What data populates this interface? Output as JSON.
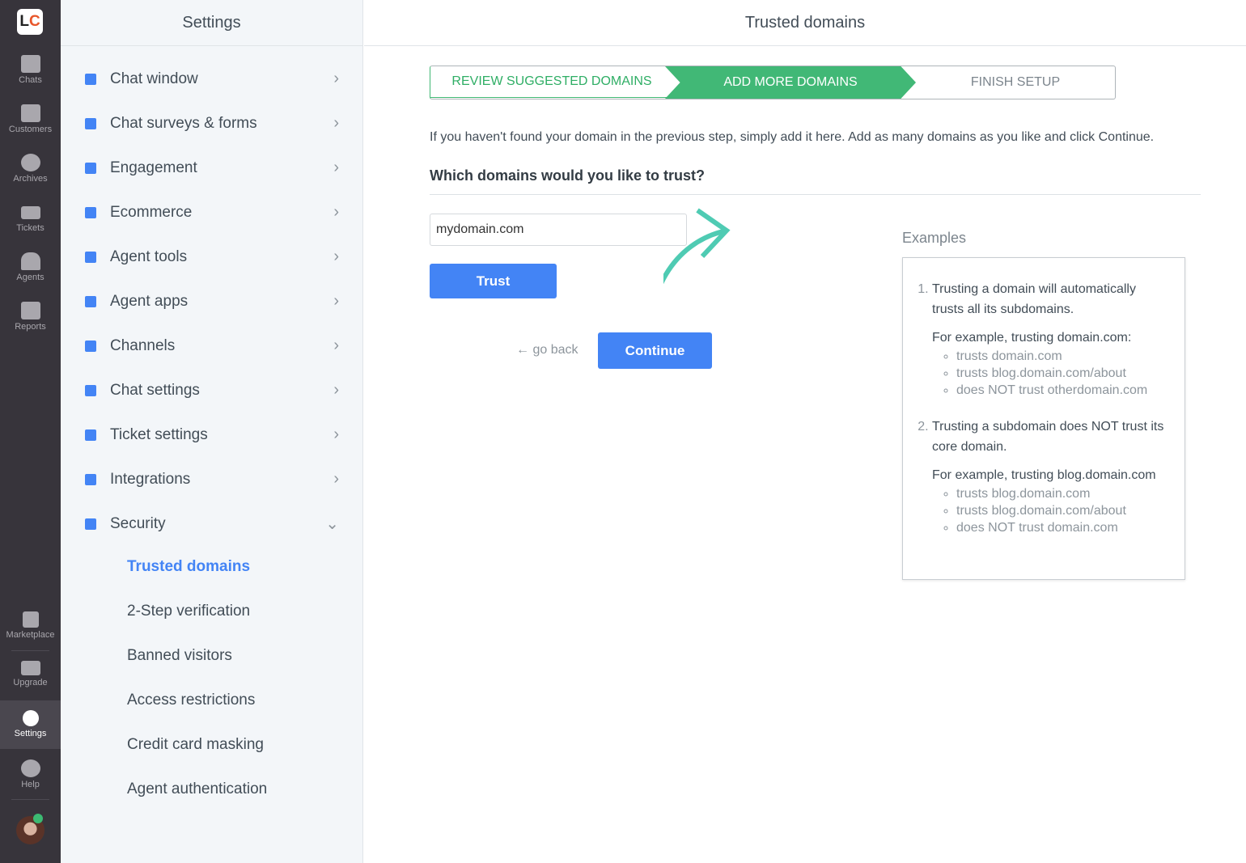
{
  "rail": {
    "logo": "LC",
    "items": [
      {
        "label": "Chats",
        "icon": "chat-icon"
      },
      {
        "label": "Customers",
        "icon": "customers-icon"
      },
      {
        "label": "Archives",
        "icon": "clock-icon"
      },
      {
        "label": "Tickets",
        "icon": "ticket-icon"
      },
      {
        "label": "Agents",
        "icon": "agents-icon"
      },
      {
        "label": "Reports",
        "icon": "reports-icon"
      }
    ],
    "bottom": [
      {
        "label": "Marketplace",
        "icon": "grid-icon"
      },
      {
        "label": "Upgrade",
        "icon": "card-icon"
      },
      {
        "label": "Settings",
        "icon": "gear-icon",
        "active": true
      },
      {
        "label": "Help",
        "icon": "help-icon"
      }
    ],
    "status_color": "#3cba72"
  },
  "sidebar": {
    "title": "Settings",
    "items": [
      {
        "label": "Chat window"
      },
      {
        "label": "Chat surveys & forms"
      },
      {
        "label": "Engagement"
      },
      {
        "label": "Ecommerce"
      },
      {
        "label": "Agent tools"
      },
      {
        "label": "Agent apps"
      },
      {
        "label": "Channels"
      },
      {
        "label": "Chat settings"
      },
      {
        "label": "Ticket settings"
      },
      {
        "label": "Integrations"
      },
      {
        "label": "Security",
        "expanded": true
      }
    ],
    "security_sub": [
      {
        "label": "Trusted domains",
        "active": true
      },
      {
        "label": "2-Step verification"
      },
      {
        "label": "Banned visitors"
      },
      {
        "label": "Access restrictions"
      },
      {
        "label": "Credit card masking"
      },
      {
        "label": "Agent authentication"
      }
    ]
  },
  "main": {
    "title": "Trusted domains",
    "steps": [
      {
        "label": "REVIEW SUGGESTED DOMAINS",
        "state": "done"
      },
      {
        "label": "ADD MORE DOMAINS",
        "state": "active"
      },
      {
        "label": "FINISH SETUP",
        "state": "pending"
      }
    ],
    "intro": "If you haven't found your domain in the previous step, simply add it here. Add as many domains as you like and click Continue.",
    "question": "Which domains would you like to trust?",
    "domain_input": "mydomain.com",
    "trust": "Trust",
    "back": "← go back",
    "continue": "Continue",
    "examples": {
      "title": "Examples",
      "e1": "Trusting a domain will automatically trusts all its subdomains.",
      "e1_for": "For example, trusting domain.com:",
      "e1_list": [
        "trusts domain.com",
        "trusts blog.domain.com/about",
        "does NOT trust otherdomain.com"
      ],
      "e2": "Trusting a subdomain does NOT trust its core domain.",
      "e2_for": "For example, trusting blog.domain.com",
      "e2_list": [
        "trusts blog.domain.com",
        "trusts blog.domain.com/about",
        "does NOT trust domain.com"
      ]
    }
  },
  "colors": {
    "accent": "#4384f5",
    "green": "#41b876",
    "arrow": "#4fcbb3",
    "rail": "#37343b"
  }
}
